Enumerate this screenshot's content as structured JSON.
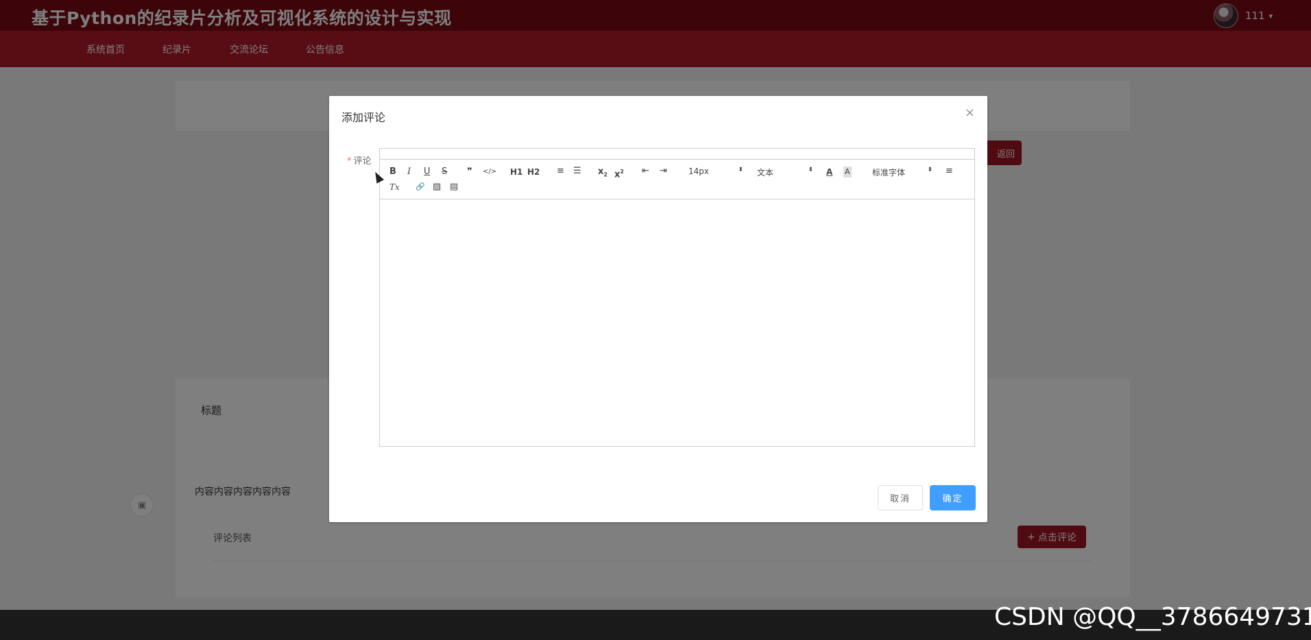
{
  "header": {
    "site_title": "基于Python的纪录片分析及可视化系统的设计与实现",
    "user_name": "111",
    "caret": "▾"
  },
  "nav": {
    "items": [
      {
        "label": "系统首页"
      },
      {
        "label": "纪录片"
      },
      {
        "label": "交流论坛"
      },
      {
        "label": "公告信息"
      }
    ]
  },
  "page": {
    "back_button": "返回",
    "title_label": "标题",
    "content_text": "内容内容内容内容内容",
    "comment_list_label": "评论列表",
    "add_comment_button": "点击评论",
    "plus": "+",
    "float_icon": "▣"
  },
  "dialog": {
    "title": "添加评论",
    "close": "×",
    "field_label": "评论",
    "required_mark": "*",
    "cancel": "取消",
    "confirm": "确定"
  },
  "toolbar": {
    "bold": "B",
    "italic": "I",
    "underline": "U",
    "strike": "S",
    "blockquote": "❞",
    "code": "</>",
    "h1": "H1",
    "h2": "H2",
    "ordered_list": "≡",
    "bullet_list": "☰",
    "sub_base": "x",
    "sub_mark": "2",
    "sup_base": "x",
    "sup_mark": "2",
    "indent_dec": "⇤",
    "indent_inc": "⇥",
    "size": "14px",
    "header": "文本",
    "color": "A",
    "background": "A",
    "font": "标准字体",
    "align": "≡",
    "clean": "Tx",
    "link": "🔗",
    "image": "▨",
    "video": "▤",
    "select_arrow": "⬍"
  },
  "watermark": "CSDN @QQ__3786649731",
  "colors": {
    "topbar": "#7a0a14",
    "navbar": "#b01a28",
    "primary_button": "#409eff",
    "accent_red": "#a01522"
  }
}
